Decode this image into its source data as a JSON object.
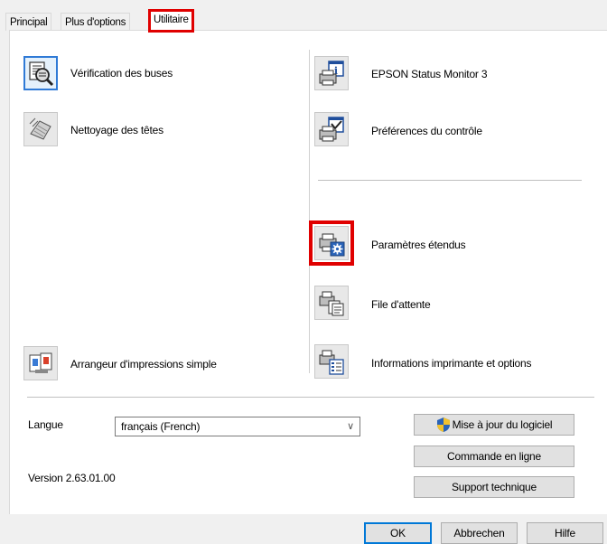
{
  "tabs": [
    {
      "label": "Principal"
    },
    {
      "label": "Plus d'options"
    },
    {
      "label": "Utilitaire"
    }
  ],
  "utilities": {
    "nozzle_check": "Vérification des buses",
    "head_cleaning": "Nettoyage des têtes",
    "simple_layout": "Arrangeur d'impressions simple",
    "status_monitor": "EPSON Status Monitor 3",
    "monitor_prefs": "Préférences du contrôle",
    "extended_settings": "Paramètres étendus",
    "print_queue": "File d'attente",
    "printer_info": "Informations imprimante et options"
  },
  "language": {
    "label": "Langue",
    "selected": "français (French)"
  },
  "version": "Version 2.63.01.00",
  "side_buttons": {
    "update": "Mise à jour du logiciel",
    "order_online": "Commande en ligne",
    "support": "Support technique"
  },
  "dialog_buttons": {
    "ok": "OK",
    "cancel": "Abbrechen",
    "help": "Hilfe"
  },
  "colors": {
    "highlight": "#e00000",
    "focus": "#2f7ad6"
  }
}
